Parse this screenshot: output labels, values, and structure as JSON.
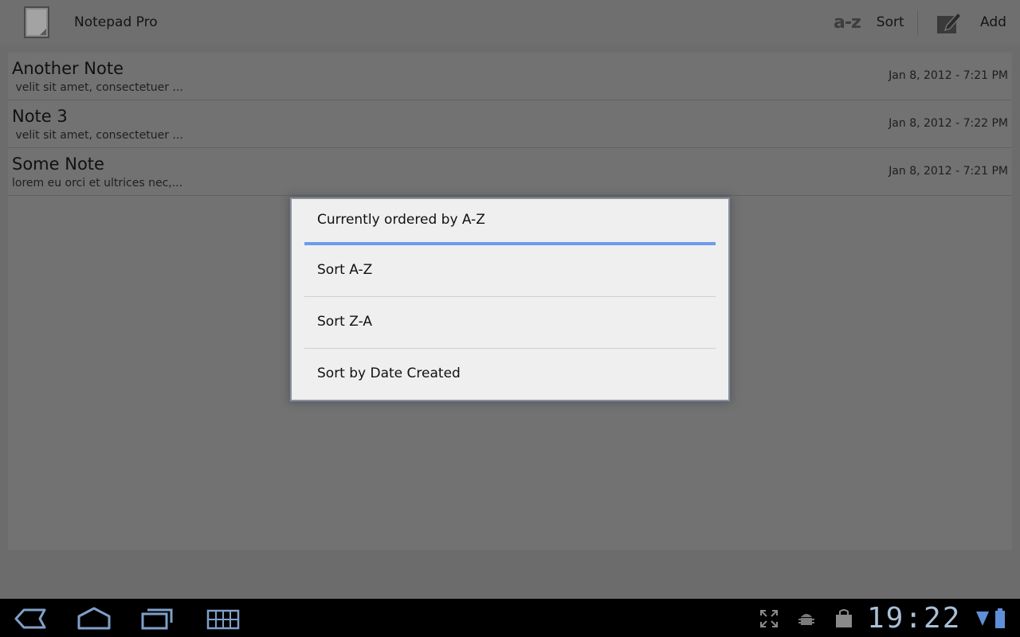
{
  "app": {
    "title": "Notepad Pro"
  },
  "actions": {
    "sort_glyph": "a-z",
    "sort_label": "Sort",
    "add_label": "Add"
  },
  "notes": [
    {
      "title": "Another Note",
      "snippet": " velit sit amet, consectetuer ...",
      "date": "Jan 8, 2012 - 7:21 PM"
    },
    {
      "title": "Note 3",
      "snippet": " velit sit amet, consectetuer ...",
      "date": "Jan 8, 2012 - 7:22 PM"
    },
    {
      "title": "Some Note",
      "snippet": "lorem eu orci et ultrices nec,...",
      "date": "Jan 8, 2012 - 7:21 PM"
    }
  ],
  "dialog": {
    "title": "Currently ordered by A-Z",
    "options": [
      "Sort A-Z",
      "Sort Z-A",
      "Sort by Date Created"
    ]
  },
  "system_bar": {
    "time": "19:22",
    "icons": [
      "back-icon",
      "home-icon",
      "recent-apps-icon",
      "keyboard-icon",
      "fullscreen-icon",
      "android-debug-icon",
      "shopping-bag-icon",
      "wifi-icon",
      "battery-icon"
    ]
  },
  "colors": {
    "accent": "#6d9bee",
    "dialog_bg": "#efefef",
    "system_icon": "#7f9fc9"
  }
}
